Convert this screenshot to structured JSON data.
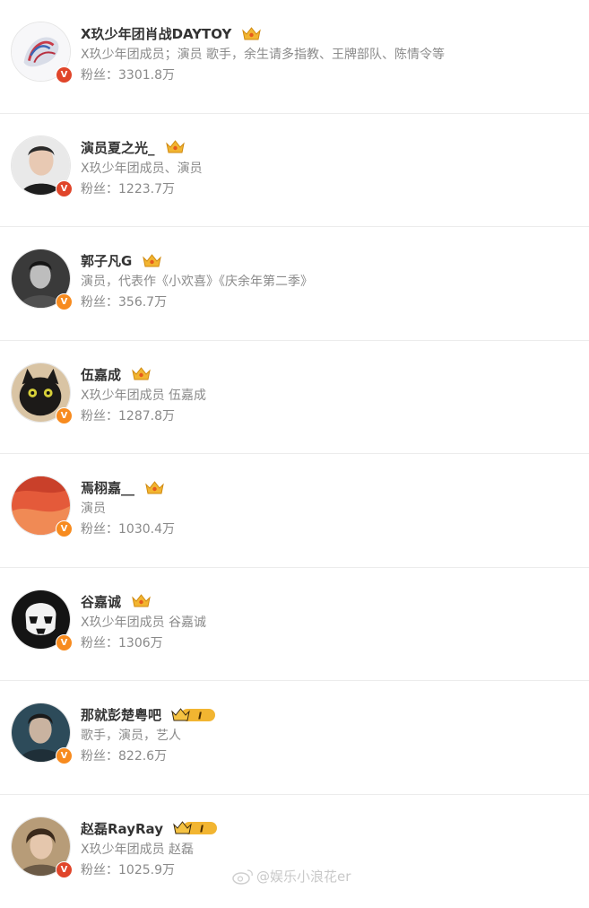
{
  "accounts": [
    {
      "name": "X玖少年团肖战DAYTOY",
      "desc": "X玖少年团成员；演员 歌手，余生请多指教、王牌部队、陈情令等",
      "fans": "粉丝：3301.8万",
      "badge": "crown",
      "verify": "red-v"
    },
    {
      "name": "演员夏之光_",
      "desc": "X玖少年团成员、演员",
      "fans": "粉丝：1223.7万",
      "badge": "crown",
      "verify": "red-v"
    },
    {
      "name": "郭子凡G",
      "desc": "演员，代表作《小欢喜》《庆余年第二季》",
      "fans": "粉丝：356.7万",
      "badge": "crown",
      "verify": "orange-v"
    },
    {
      "name": "伍嘉成",
      "desc": "X玖少年团成员 伍嘉成",
      "fans": "粉丝：1287.8万",
      "badge": "crown",
      "verify": "orange-v"
    },
    {
      "name": "焉栩嘉__",
      "desc": "演员",
      "fans": "粉丝：1030.4万",
      "badge": "crown",
      "verify": "orange-v"
    },
    {
      "name": "谷嘉诚",
      "desc": "X玖少年团成员 谷嘉诚",
      "fans": "粉丝：1306万",
      "badge": "crown",
      "verify": "orange-v"
    },
    {
      "name": "那就彭楚粤吧",
      "desc": "歌手，演员，艺人",
      "fans": "粉丝：822.6万",
      "badge": "crown-level-1",
      "verify": "orange-v"
    },
    {
      "name": "赵磊RayRay",
      "desc": "X玖少年团成员 赵磊",
      "fans": "粉丝：1025.9万",
      "badge": "crown-level-1",
      "verify": "red-v"
    }
  ],
  "verify_mark": "V",
  "level_mark": "I",
  "watermark": "@娱乐小浪花er",
  "colors": {
    "name": "#333333",
    "secondary": "#8a8a8a",
    "verify_orange": "#f78b1f",
    "verify_red": "#e0452a",
    "crown_gold": "#f2b531"
  }
}
